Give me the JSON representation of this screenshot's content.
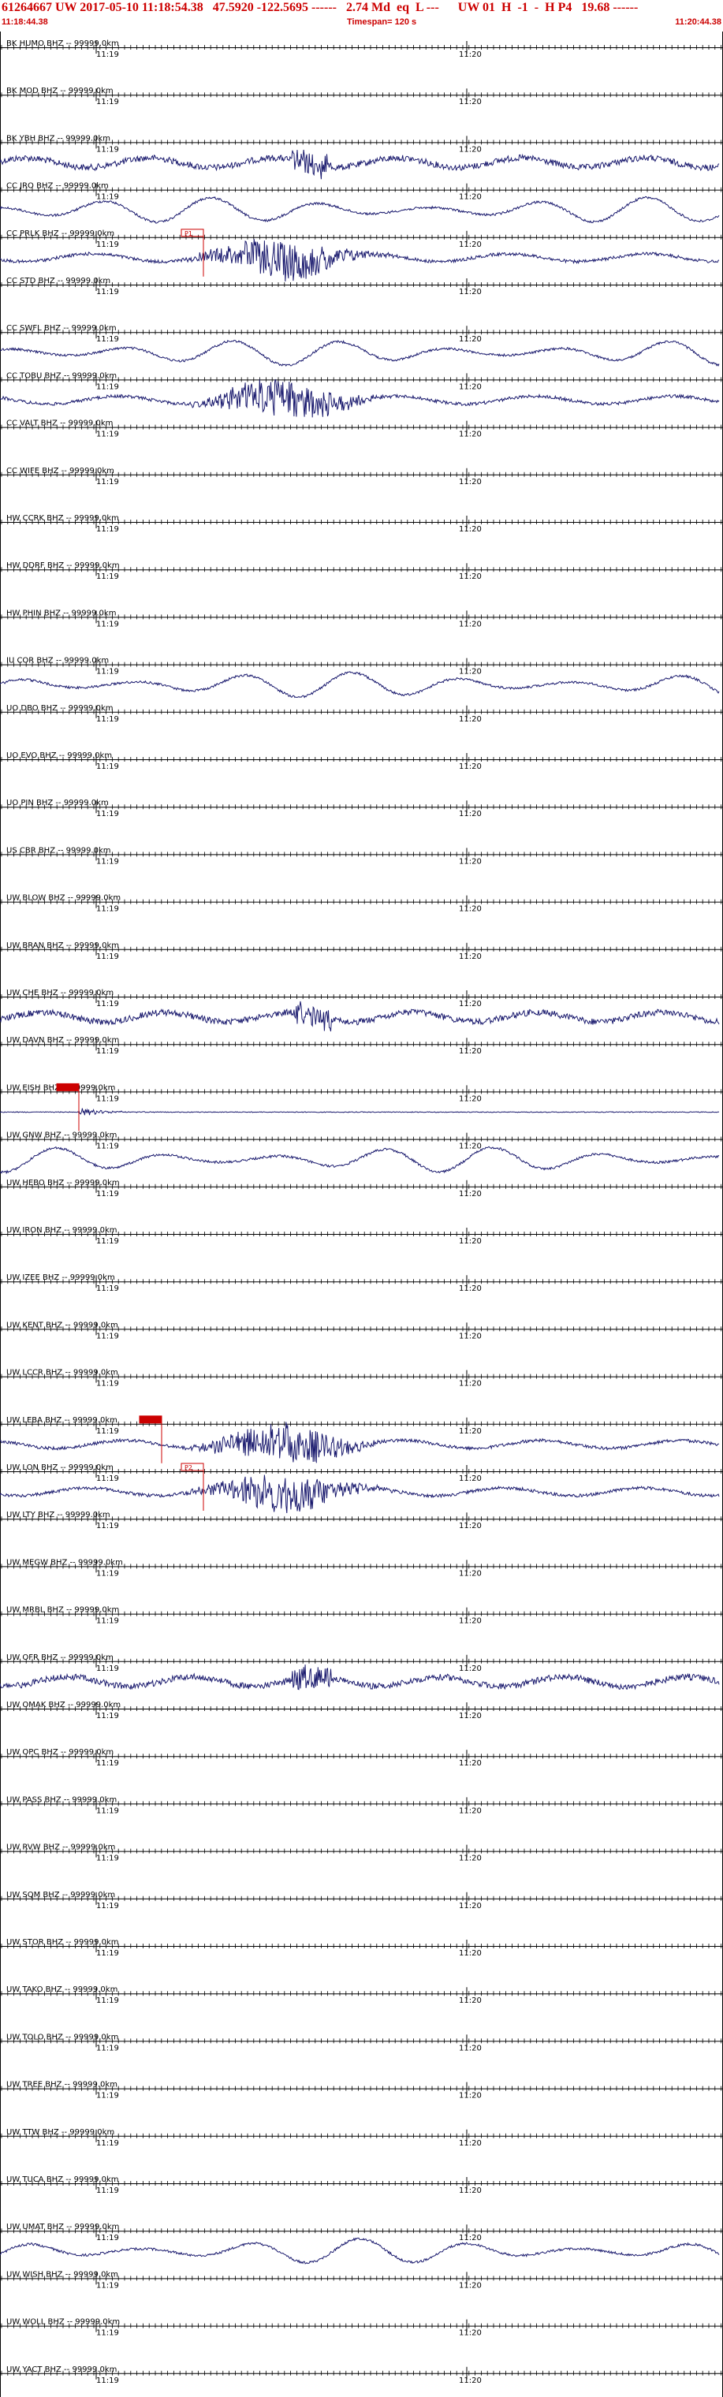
{
  "header": {
    "title_line": "61264667 UW 2017-05-10 11:18:54.38   47.5920 -122.5695 ------   2.74 Md  eq  L ---      UW 01  H  -1  -  H P4   19.68 ------",
    "start_time": "11:18:44.38",
    "timespan": "Timespan= 120 s",
    "end_time": "11:20:44.38",
    "colors": {
      "header_text": "#cc0000",
      "trace": "#1a1a6e",
      "pick": "#cc0000",
      "axis": "#000000"
    }
  },
  "time_axis": {
    "minute_labels": [
      "11:19",
      "11:20"
    ]
  },
  "chart_data": {
    "type": "line",
    "title": "",
    "xlabel": "",
    "ylabel": "",
    "timespan_s": 120,
    "channels": [
      {
        "label": "BK HUMO BHZ -- 99999.0km",
        "signal": "none"
      },
      {
        "label": "BK MOD BHZ -- 99999.0km",
        "signal": "none"
      },
      {
        "label": "BK YBH BHZ -- 99999.0km",
        "signal": "noise_burst"
      },
      {
        "label": "CC JRO BHZ -- 99999.0km",
        "signal": "microseism"
      },
      {
        "label": "CC PRLK BHZ -- 99999.0km",
        "signal": "event",
        "pick": "P1"
      },
      {
        "label": "CC STD BHZ -- 99999.0km",
        "signal": "none"
      },
      {
        "label": "CC SWFL BHZ -- 99999.0km",
        "signal": "microseism"
      },
      {
        "label": "CC TOBU BHZ -- 99999.0km",
        "signal": "event"
      },
      {
        "label": "CC VALT BHZ -- 99999.0km",
        "signal": "none"
      },
      {
        "label": "CC WIFE BHZ -- 99999.0km",
        "signal": "none"
      },
      {
        "label": "HW CCRK BHZ -- 99999.0km",
        "signal": "none"
      },
      {
        "label": "HW DDRF BHZ -- 99999.0km",
        "signal": "none"
      },
      {
        "label": "HW PHIN BHZ -- 99999.0km",
        "signal": "none"
      },
      {
        "label": "IU COR BHZ -- 99999.0km",
        "signal": "microseism"
      },
      {
        "label": "UO DBO BHZ -- 99999.0km",
        "signal": "none"
      },
      {
        "label": "UO EVO BHZ -- 99999.0km",
        "signal": "none"
      },
      {
        "label": "UO PIN BHZ -- 99999.0km",
        "signal": "none"
      },
      {
        "label": "US CBR BHZ -- 99999.0km",
        "signal": "none"
      },
      {
        "label": "UW BLOW BHZ -- 99999.0km",
        "signal": "none"
      },
      {
        "label": "UW BRAN BHZ -- 99999.0km",
        "signal": "none"
      },
      {
        "label": "UW CHE BHZ -- 99999.0km",
        "signal": "noise_burst"
      },
      {
        "label": "UW DAVN BHZ -- 99999.0km",
        "signal": "none"
      },
      {
        "label": "UW EISH BHZ -- 99999.0km",
        "signal": "event_small",
        "pick": ""
      },
      {
        "label": "UW GNW BHZ -- 99999.0km",
        "signal": "microseism"
      },
      {
        "label": "UW HEBO BHZ -- 99999.0km",
        "signal": "none"
      },
      {
        "label": "UW IRON BHZ -- 99999.0km",
        "signal": "none"
      },
      {
        "label": "UW IZEE BHZ -- 99999.0km",
        "signal": "none"
      },
      {
        "label": "UW KENT BHZ -- 99999.0km",
        "signal": "none"
      },
      {
        "label": "UW LCCR BHZ -- 99999.0km",
        "signal": "none"
      },
      {
        "label": "UW LEBA BHZ -- 99999.0km",
        "signal": "event",
        "pick": ""
      },
      {
        "label": "UW LON BHZ -- 99999.0km",
        "signal": "event",
        "pick": "P2"
      },
      {
        "label": "UW LTY BHZ -- 99999.0km",
        "signal": "none"
      },
      {
        "label": "UW MEGW BHZ -- 99999.0km",
        "signal": "none"
      },
      {
        "label": "UW MRBL BHZ -- 99999.0km",
        "signal": "none"
      },
      {
        "label": "UW OFR BHZ -- 99999.0km",
        "signal": "noise_burst"
      },
      {
        "label": "UW OMAK BHZ -- 99999.0km",
        "signal": "none"
      },
      {
        "label": "UW OPC BHZ -- 99999.0km",
        "signal": "none"
      },
      {
        "label": "UW PASS BHZ -- 99999.0km",
        "signal": "none"
      },
      {
        "label": "UW RVW BHZ -- 99999.0km",
        "signal": "none"
      },
      {
        "label": "UW SQM BHZ -- 99999.0km",
        "signal": "none"
      },
      {
        "label": "UW STOR BHZ -- 99999.0km",
        "signal": "none"
      },
      {
        "label": "UW TAKO BHZ -- 99999.0km",
        "signal": "none"
      },
      {
        "label": "UW TOLO BHZ -- 99999.0km",
        "signal": "none"
      },
      {
        "label": "UW TREE BHZ -- 99999.0km",
        "signal": "none"
      },
      {
        "label": "UW TTW BHZ -- 99999.0km",
        "signal": "none"
      },
      {
        "label": "UW TUCA BHZ -- 99999.0km",
        "signal": "none"
      },
      {
        "label": "UW UMAT BHZ -- 99999.0km",
        "signal": "microseism"
      },
      {
        "label": "UW WISH BHZ -- 99999.0km",
        "signal": "none"
      },
      {
        "label": "UW WOLL BHZ -- 99999.0km",
        "signal": "none"
      },
      {
        "label": "UW YACT BHZ -- 99999.0km",
        "signal": "none"
      }
    ]
  }
}
